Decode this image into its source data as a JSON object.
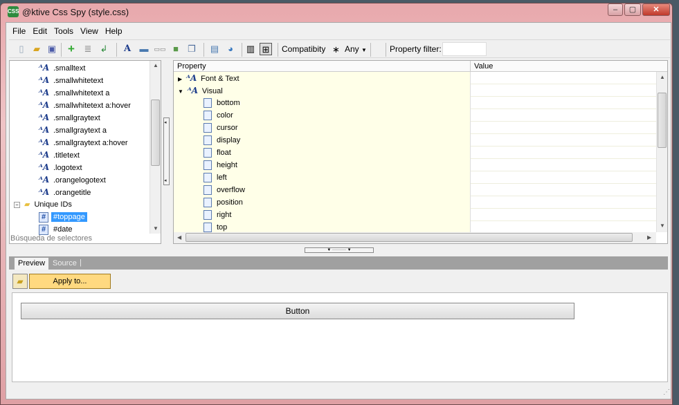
{
  "window": {
    "title": "@ktive Css Spy (style.css)",
    "app_icon": "CSS"
  },
  "menu": [
    "File",
    "Edit",
    "Tools",
    "View",
    "Help"
  ],
  "toolbar": {
    "compat_label": "Compatibity",
    "compat_symbol": "∗",
    "compat_value": "Any",
    "filter_label": "Property filter:",
    "filter_value": ""
  },
  "tree": {
    "classes": [
      ".smalltext",
      ".smallwhitetext",
      ".smallwhitetext a",
      ".smallwhitetext a:hover",
      ".smallgraytext",
      ".smallgraytext a",
      ".smallgraytext a:hover",
      ".titletext",
      ".logotext",
      ".orangelogotext",
      ".orangetitle"
    ],
    "folder": "Unique IDs",
    "ids": [
      "#toppage",
      "#date"
    ],
    "selected": "#toppage",
    "search_placeholder": "Búsqueda de selectores"
  },
  "grid": {
    "headers": [
      "Property",
      "Value"
    ],
    "groups": [
      "Font & Text",
      "Visual"
    ],
    "properties": [
      "bottom",
      "color",
      "cursor",
      "display",
      "float",
      "height",
      "left",
      "overflow",
      "position",
      "right",
      "top"
    ]
  },
  "tabs": [
    "Preview",
    "Source"
  ],
  "apply_label": "Apply to...",
  "preview_button": "Button",
  "colors": {
    "selection": "#3399ff",
    "apply_bg": "#ffd980",
    "prop_bg": "#ffffe8"
  }
}
